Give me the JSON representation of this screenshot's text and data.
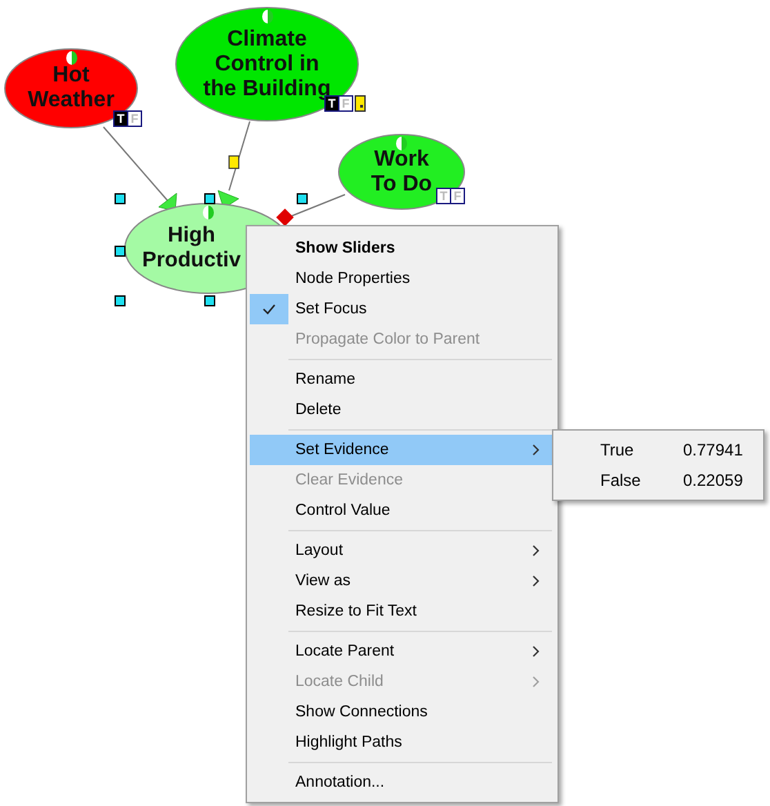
{
  "nodes": [
    {
      "label": "Hot\nWeather",
      "color": "#ff0000",
      "badges": [
        {
          "text": "T",
          "active": true
        },
        {
          "text": "F",
          "active": false
        }
      ]
    },
    {
      "label": "Climate\nControl in\nthe Building",
      "color": "#00e600",
      "badges": [
        {
          "text": "T",
          "active": true
        },
        {
          "text": "F",
          "active": false
        }
      ],
      "note": true
    },
    {
      "label": "Work\nTo Do",
      "color": "#22ee22",
      "badges": [
        {
          "text": "T",
          "active": false
        },
        {
          "text": "F",
          "active": false
        }
      ]
    },
    {
      "label": "High\nProductiv",
      "color": "#a4faa4"
    }
  ],
  "context_menu": {
    "items": [
      {
        "kind": "item",
        "label": "Show Sliders",
        "bold": true,
        "disabled": false,
        "checked": false,
        "selected": false,
        "submenu": false
      },
      {
        "kind": "item",
        "label": "Node Properties",
        "bold": false,
        "disabled": false,
        "checked": false,
        "selected": false,
        "submenu": false
      },
      {
        "kind": "item",
        "label": "Set Focus",
        "bold": false,
        "disabled": false,
        "checked": true,
        "selected": false,
        "submenu": false
      },
      {
        "kind": "item",
        "label": "Propagate Color to Parent",
        "bold": false,
        "disabled": true,
        "checked": false,
        "selected": false,
        "submenu": false
      },
      {
        "kind": "separator"
      },
      {
        "kind": "item",
        "label": "Rename",
        "bold": false,
        "disabled": false,
        "checked": false,
        "selected": false,
        "submenu": false
      },
      {
        "kind": "item",
        "label": "Delete",
        "bold": false,
        "disabled": false,
        "checked": false,
        "selected": false,
        "submenu": false
      },
      {
        "kind": "separator"
      },
      {
        "kind": "item",
        "label": "Set Evidence",
        "bold": false,
        "disabled": false,
        "checked": false,
        "selected": true,
        "submenu": true
      },
      {
        "kind": "item",
        "label": "Clear Evidence",
        "bold": false,
        "disabled": true,
        "checked": false,
        "selected": false,
        "submenu": false
      },
      {
        "kind": "item",
        "label": "Control Value",
        "bold": false,
        "disabled": false,
        "checked": false,
        "selected": false,
        "submenu": false
      },
      {
        "kind": "separator"
      },
      {
        "kind": "item",
        "label": "Layout",
        "bold": false,
        "disabled": false,
        "checked": false,
        "selected": false,
        "submenu": true
      },
      {
        "kind": "item",
        "label": "View as",
        "bold": false,
        "disabled": false,
        "checked": false,
        "selected": false,
        "submenu": true
      },
      {
        "kind": "item",
        "label": "Resize to Fit Text",
        "bold": false,
        "disabled": false,
        "checked": false,
        "selected": false,
        "submenu": false
      },
      {
        "kind": "separator"
      },
      {
        "kind": "item",
        "label": "Locate Parent",
        "bold": false,
        "disabled": false,
        "checked": false,
        "selected": false,
        "submenu": true
      },
      {
        "kind": "item",
        "label": "Locate Child",
        "bold": false,
        "disabled": true,
        "checked": false,
        "selected": false,
        "submenu": true
      },
      {
        "kind": "item",
        "label": "Show Connections",
        "bold": false,
        "disabled": false,
        "checked": false,
        "selected": false,
        "submenu": false
      },
      {
        "kind": "item",
        "label": "Highlight Paths",
        "bold": false,
        "disabled": false,
        "checked": false,
        "selected": false,
        "submenu": false
      },
      {
        "kind": "separator"
      },
      {
        "kind": "item",
        "label": "Annotation...",
        "bold": false,
        "disabled": false,
        "checked": false,
        "selected": false,
        "submenu": false
      }
    ]
  },
  "evidence_submenu": {
    "items": [
      {
        "state": "True",
        "value": "0.77941"
      },
      {
        "state": "False",
        "value": "0.22059"
      }
    ]
  }
}
